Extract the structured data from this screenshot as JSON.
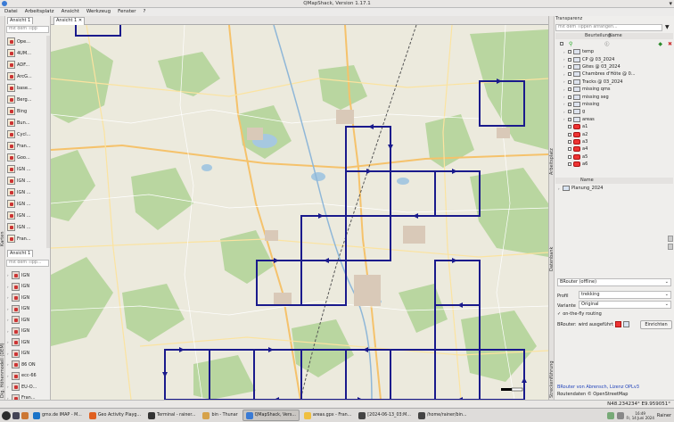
{
  "window": {
    "title": "QMapShack, Version 1.17.1"
  },
  "menu": [
    "Datei",
    "Arbeitsplatz",
    "Ansicht",
    "Werkzeug",
    "Fenster",
    "?"
  ],
  "left_dock": {
    "maps_tab": "Ansicht 1",
    "maps_filter": "mit dem Tipp",
    "maps_side_label": "Karten",
    "maps": [
      "Ope...",
      "4UM...",
      "ADF...",
      "ArcG...",
      "base...",
      "Berg...",
      "Bing",
      "Bun...",
      "Cycl...",
      "Fran...",
      "Goo...",
      "IGN ...",
      "IGN ...",
      "IGN ...",
      "IGN ...",
      "IGN ...",
      "IGN ...",
      "Fran..."
    ],
    "dem_tab": "Ansicht 1",
    "dem_filter": "mit dem Tipp...",
    "dem_side_label": "Dig. Höhenmodell (DEM)",
    "dem": [
      "IGN",
      "IGN",
      "IGN",
      "IGN",
      "IGN",
      "IGN",
      "IGN",
      "IGN",
      "86 ON",
      "ecc-66",
      "EU-O...",
      "Fran..."
    ]
  },
  "map": {
    "tab": "Ansicht 1"
  },
  "right_dock": {
    "transparency_label": "Transparenz",
    "filter_placeholder": "mit dem Tippen anfangen...",
    "col_rating": "Beurteilung",
    "col_name": "Name",
    "workspace_side_label": "Arbeitsplatz",
    "projects": [
      "temp",
      "CP @ 03_2024",
      "Gites @ 03_2024",
      "Chambres d'Hôte @ 0...",
      "Tracks @ 03_2024",
      "missing qms",
      "missing seg",
      "missing",
      "g",
      "areas",
      "a1",
      "a2",
      "a3",
      "a4",
      "a5",
      "a6"
    ],
    "db_header": "Name",
    "db_side_label": "Datenbank",
    "db_items": [
      "Planung_2024"
    ],
    "router_side_label": "Streckenführung",
    "router_select": "BRouter (offline)",
    "profile_label": "Profil",
    "profile_value": "trekking",
    "variant_label": "Variante",
    "variant_value": "Original",
    "onthefly": "on-the-fly routing",
    "brouter_status_label": "BRouter:",
    "brouter_status": "wird ausgeführt",
    "setup_button": "Einrichten",
    "credits_1": "BRouter von Abrensch, Lizenz OPLv3",
    "credits_2": "Routendaten © OpenStreetMap"
  },
  "statusbar": {
    "coords": "N48.234234° E9.959051°"
  },
  "taskbar": {
    "items": [
      "gmx.de IMAP - M...",
      "Geo Activity Playg...",
      "Terminal - rainer...",
      "bin - Thunar",
      "QMapShack, Vers...",
      "areas.gpx - Fran...",
      "[2024-06-13_03:M...",
      "/home/rainer/bin..."
    ],
    "clock_time": "16:49",
    "clock_date": "Fr, 14 Juni 2024",
    "user": "Rainer"
  },
  "colors": {
    "track": "#1a1a8c",
    "accent": "#3a7bd5",
    "area_red": "#e33333"
  }
}
